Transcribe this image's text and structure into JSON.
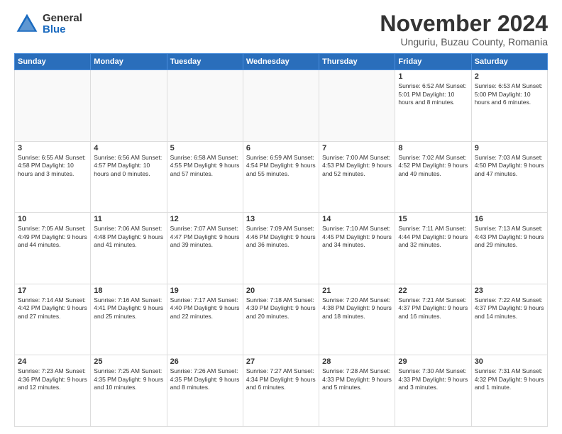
{
  "logo": {
    "general": "General",
    "blue": "Blue"
  },
  "header": {
    "title": "November 2024",
    "subtitle": "Unguriu, Buzau County, Romania"
  },
  "days_of_week": [
    "Sunday",
    "Monday",
    "Tuesday",
    "Wednesday",
    "Thursday",
    "Friday",
    "Saturday"
  ],
  "weeks": [
    [
      {
        "day": "",
        "info": ""
      },
      {
        "day": "",
        "info": ""
      },
      {
        "day": "",
        "info": ""
      },
      {
        "day": "",
        "info": ""
      },
      {
        "day": "",
        "info": ""
      },
      {
        "day": "1",
        "info": "Sunrise: 6:52 AM\nSunset: 5:01 PM\nDaylight: 10 hours and 8 minutes."
      },
      {
        "day": "2",
        "info": "Sunrise: 6:53 AM\nSunset: 5:00 PM\nDaylight: 10 hours and 6 minutes."
      }
    ],
    [
      {
        "day": "3",
        "info": "Sunrise: 6:55 AM\nSunset: 4:58 PM\nDaylight: 10 hours and 3 minutes."
      },
      {
        "day": "4",
        "info": "Sunrise: 6:56 AM\nSunset: 4:57 PM\nDaylight: 10 hours and 0 minutes."
      },
      {
        "day": "5",
        "info": "Sunrise: 6:58 AM\nSunset: 4:55 PM\nDaylight: 9 hours and 57 minutes."
      },
      {
        "day": "6",
        "info": "Sunrise: 6:59 AM\nSunset: 4:54 PM\nDaylight: 9 hours and 55 minutes."
      },
      {
        "day": "7",
        "info": "Sunrise: 7:00 AM\nSunset: 4:53 PM\nDaylight: 9 hours and 52 minutes."
      },
      {
        "day": "8",
        "info": "Sunrise: 7:02 AM\nSunset: 4:52 PM\nDaylight: 9 hours and 49 minutes."
      },
      {
        "day": "9",
        "info": "Sunrise: 7:03 AM\nSunset: 4:50 PM\nDaylight: 9 hours and 47 minutes."
      }
    ],
    [
      {
        "day": "10",
        "info": "Sunrise: 7:05 AM\nSunset: 4:49 PM\nDaylight: 9 hours and 44 minutes."
      },
      {
        "day": "11",
        "info": "Sunrise: 7:06 AM\nSunset: 4:48 PM\nDaylight: 9 hours and 41 minutes."
      },
      {
        "day": "12",
        "info": "Sunrise: 7:07 AM\nSunset: 4:47 PM\nDaylight: 9 hours and 39 minutes."
      },
      {
        "day": "13",
        "info": "Sunrise: 7:09 AM\nSunset: 4:46 PM\nDaylight: 9 hours and 36 minutes."
      },
      {
        "day": "14",
        "info": "Sunrise: 7:10 AM\nSunset: 4:45 PM\nDaylight: 9 hours and 34 minutes."
      },
      {
        "day": "15",
        "info": "Sunrise: 7:11 AM\nSunset: 4:44 PM\nDaylight: 9 hours and 32 minutes."
      },
      {
        "day": "16",
        "info": "Sunrise: 7:13 AM\nSunset: 4:43 PM\nDaylight: 9 hours and 29 minutes."
      }
    ],
    [
      {
        "day": "17",
        "info": "Sunrise: 7:14 AM\nSunset: 4:42 PM\nDaylight: 9 hours and 27 minutes."
      },
      {
        "day": "18",
        "info": "Sunrise: 7:16 AM\nSunset: 4:41 PM\nDaylight: 9 hours and 25 minutes."
      },
      {
        "day": "19",
        "info": "Sunrise: 7:17 AM\nSunset: 4:40 PM\nDaylight: 9 hours and 22 minutes."
      },
      {
        "day": "20",
        "info": "Sunrise: 7:18 AM\nSunset: 4:39 PM\nDaylight: 9 hours and 20 minutes."
      },
      {
        "day": "21",
        "info": "Sunrise: 7:20 AM\nSunset: 4:38 PM\nDaylight: 9 hours and 18 minutes."
      },
      {
        "day": "22",
        "info": "Sunrise: 7:21 AM\nSunset: 4:37 PM\nDaylight: 9 hours and 16 minutes."
      },
      {
        "day": "23",
        "info": "Sunrise: 7:22 AM\nSunset: 4:37 PM\nDaylight: 9 hours and 14 minutes."
      }
    ],
    [
      {
        "day": "24",
        "info": "Sunrise: 7:23 AM\nSunset: 4:36 PM\nDaylight: 9 hours and 12 minutes."
      },
      {
        "day": "25",
        "info": "Sunrise: 7:25 AM\nSunset: 4:35 PM\nDaylight: 9 hours and 10 minutes."
      },
      {
        "day": "26",
        "info": "Sunrise: 7:26 AM\nSunset: 4:35 PM\nDaylight: 9 hours and 8 minutes."
      },
      {
        "day": "27",
        "info": "Sunrise: 7:27 AM\nSunset: 4:34 PM\nDaylight: 9 hours and 6 minutes."
      },
      {
        "day": "28",
        "info": "Sunrise: 7:28 AM\nSunset: 4:33 PM\nDaylight: 9 hours and 5 minutes."
      },
      {
        "day": "29",
        "info": "Sunrise: 7:30 AM\nSunset: 4:33 PM\nDaylight: 9 hours and 3 minutes."
      },
      {
        "day": "30",
        "info": "Sunrise: 7:31 AM\nSunset: 4:32 PM\nDaylight: 9 hours and 1 minute."
      }
    ]
  ]
}
